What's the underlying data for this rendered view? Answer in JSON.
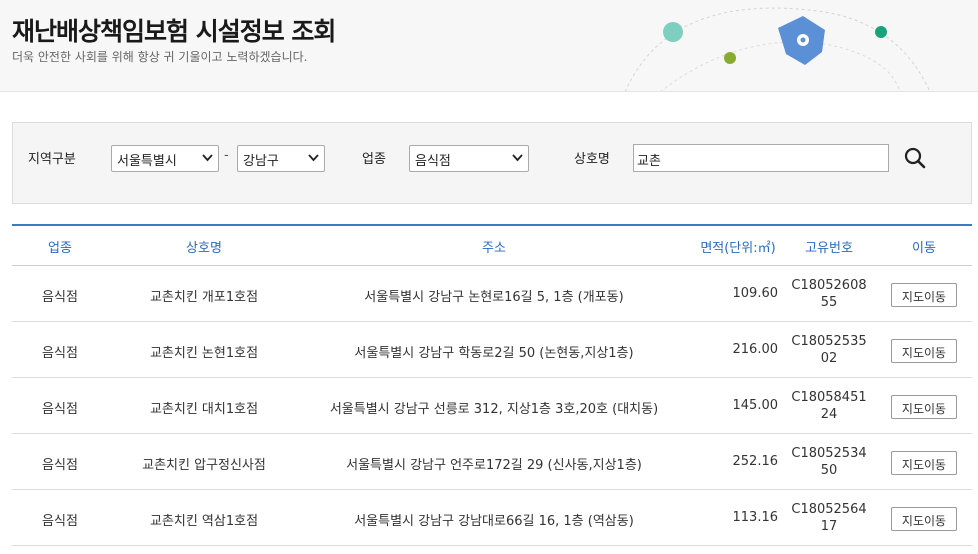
{
  "page": {
    "title": "재난배상책임보험 시설정보 조회",
    "subtitle": "더욱 안전한 사회를 위해 항상 귀 기울이고 노력하겠습니다."
  },
  "search": {
    "region_label": "지역구분",
    "region_value": "서울특별시",
    "district_value": "강남구",
    "separator": "-",
    "business_type_label": "업종",
    "business_type_value": "음식점",
    "business_name_label": "상호명",
    "business_name_value": "교촌"
  },
  "table": {
    "headers": [
      "업종",
      "상호명",
      "주소",
      "면적(단위:㎡)",
      "고유번호",
      "이동"
    ],
    "move_button_label": "지도이동",
    "rows": [
      {
        "type": "음식점",
        "name": "교촌치킨 개포1호점",
        "address": "서울특별시 강남구 논현로16길 5, 1층 (개포동)",
        "area": "109.60",
        "id": "C1805260855"
      },
      {
        "type": "음식점",
        "name": "교촌치킨 논현1호점",
        "address": "서울특별시 강남구 학동로2길 50 (논현동,지상1층)",
        "area": "216.00",
        "id": "C1805253502"
      },
      {
        "type": "음식점",
        "name": "교촌치킨 대치1호점",
        "address": "서울특별시 강남구 선릉로 312, 지상1층 3호,20호 (대치동)",
        "area": "145.00",
        "id": "C1805845124"
      },
      {
        "type": "음식점",
        "name": "교촌치킨 압구정신사점",
        "address": "서울특별시 강남구 언주로172길 29 (신사동,지상1층)",
        "area": "252.16",
        "id": "C1805253450"
      },
      {
        "type": "음식점",
        "name": "교촌치킨 역삼1호점",
        "address": "서울특별시 강남구 강남대로66길 16, 1층 (역삼동)",
        "area": "113.16",
        "id": "C1805256417"
      }
    ]
  },
  "colors": {
    "accent": "#2a6bbd",
    "shield": "#5b8fd6",
    "dot_teal": "#7fcfc0",
    "dot_green": "#8aac2e",
    "dot_emerald": "#1aa37a"
  },
  "icons": {
    "header_decoration": "shield-location-icon",
    "search_button": "search-icon",
    "select_arrow": "chevron-down-icon"
  }
}
